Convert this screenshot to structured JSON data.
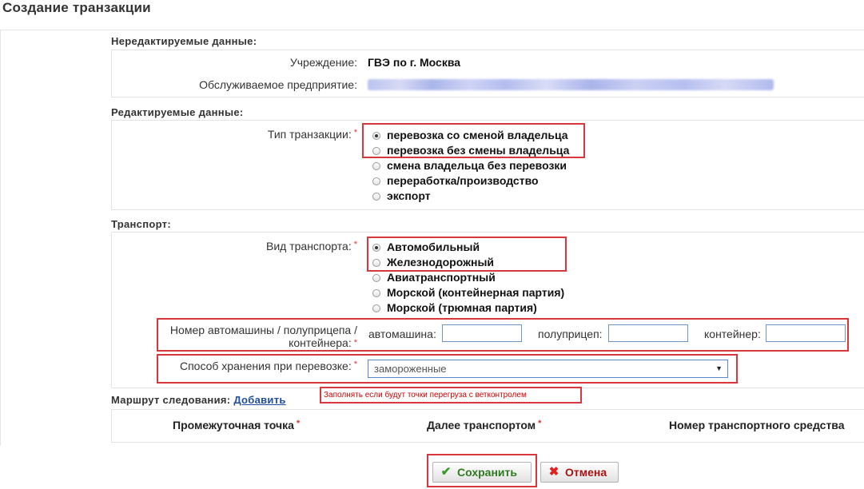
{
  "page": {
    "title": "Создание транзакции"
  },
  "readonly": {
    "section_label": "Нередактируемые данные:",
    "institution_label": "Учреждение:",
    "institution_value": "ГВЭ по г. Москва",
    "enterprise_label": "Обслуживаемое предприятие:"
  },
  "editable": {
    "section_label": "Редактируемые данные:",
    "transaction_type_label": "Тип транзакции:",
    "required_mark": "*",
    "transaction_types": [
      {
        "label": "перевозка со сменой владельца",
        "checked": true
      },
      {
        "label": "перевозка без смены владельца",
        "checked": false
      },
      {
        "label": "смена владельца без перевозки",
        "checked": false
      },
      {
        "label": "переработка/производство",
        "checked": false
      },
      {
        "label": "экспорт",
        "checked": false
      }
    ]
  },
  "transport": {
    "section_label": "Транспорт:",
    "type_label": "Вид транспорта:",
    "types": [
      {
        "label": "Автомобильный",
        "checked": true
      },
      {
        "label": "Железнодорожный",
        "checked": false
      },
      {
        "label": "Авиатранспортный",
        "checked": false
      },
      {
        "label": "Морской (контейнерная партия)",
        "checked": false
      },
      {
        "label": "Морской (трюмная партия)",
        "checked": false
      }
    ],
    "number_label_line1": "Номер автомашины / полуприцепа /",
    "number_label_line2": "контейнера:",
    "car_label": "автомашина:",
    "car_value": "",
    "trailer_label": "полуприцеп:",
    "trailer_value": "",
    "container_label": "контейнер:",
    "container_value": "",
    "storage_label": "Способ хранения при перевозке:",
    "storage_selected": "замороженные"
  },
  "route": {
    "section_label": "Маршрут следования:",
    "add_link": "Добавить",
    "hint": "Заполнять если будут точки перегруза с ветконтролем",
    "columns": [
      "Промежуточная точка",
      "Далее транспортом",
      "Номер транспортного средства"
    ]
  },
  "actions": {
    "save_label": "Сохранить",
    "cancel_label": "Отмена"
  },
  "colors": {
    "highlight_red": "#d9363e",
    "link_blue": "#1f4ea3",
    "input_border": "#6d93c7"
  }
}
